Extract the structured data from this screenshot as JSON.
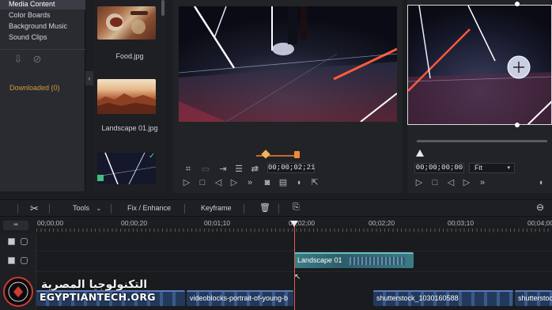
{
  "library": {
    "items": [
      {
        "label": "Media Content",
        "active": true
      },
      {
        "label": "Color Boards",
        "active": false
      },
      {
        "label": "Background Music",
        "active": false
      },
      {
        "label": "Sound Clips",
        "active": false
      }
    ],
    "downloaded_label": "Downloaded (0)"
  },
  "thumbnails": [
    {
      "label": "Food.jpg"
    },
    {
      "label": "Landscape 01.jpg"
    },
    {
      "label": ""
    }
  ],
  "preview_left": {
    "timecode": "00;00;02;21"
  },
  "preview_right": {
    "timecode": "00;00;00;00",
    "zoom": "Fit"
  },
  "timeline_toolbar": {
    "tools": "Tools",
    "fix_enhance": "Fix / Enhance",
    "keyframe": "Keyframe"
  },
  "ruler": {
    "ticks": [
      "00;00;00",
      "00;00;20",
      "00;01;10",
      "00;02;00",
      "00;02;20",
      "00;03;10",
      "00;04;00"
    ]
  },
  "tracks": {
    "overlay_clip": "Landscape 01",
    "main_clips": [
      "videoblocks-portrait-of-young-b",
      "shutterstock_1030160588",
      "shutterstock_"
    ]
  },
  "watermark": {
    "arabic": "التكنولوجيا المصرية",
    "english": "EGYPTIANTECH.ORG"
  },
  "colors": {
    "accent": "#e05b4e",
    "clip_teal": "#3a7d86",
    "clip_blue": "#2d4a80",
    "downloaded": "#d49a3a"
  }
}
